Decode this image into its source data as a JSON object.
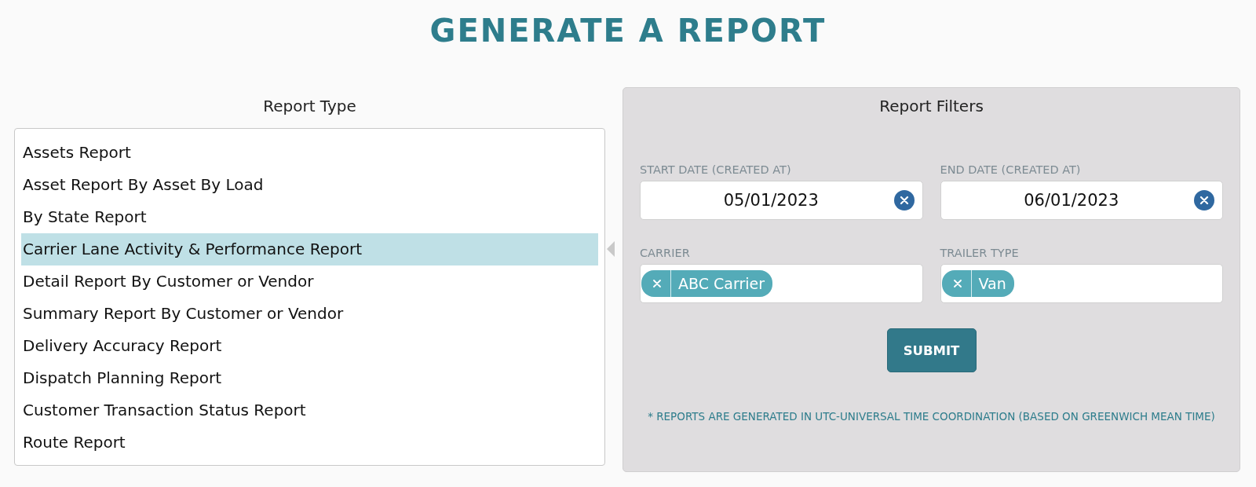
{
  "title": "GENERATE A REPORT",
  "report_type": {
    "heading": "Report Type",
    "items": [
      {
        "label": "Assets Report",
        "selected": false
      },
      {
        "label": "Asset Report By Asset By Load",
        "selected": false
      },
      {
        "label": "By State Report",
        "selected": false
      },
      {
        "label": "Carrier Lane Activity & Performance Report",
        "selected": true
      },
      {
        "label": "Detail Report By Customer or Vendor",
        "selected": false
      },
      {
        "label": "Summary Report By Customer or Vendor",
        "selected": false
      },
      {
        "label": "Delivery Accuracy Report",
        "selected": false
      },
      {
        "label": "Dispatch Planning Report",
        "selected": false
      },
      {
        "label": "Customer Transaction Status Report",
        "selected": false
      },
      {
        "label": "Route Report",
        "selected": false
      }
    ]
  },
  "report_filters": {
    "heading": "Report Filters",
    "fields": [
      {
        "kind": "date",
        "label": "START DATE (CREATED AT)",
        "value": "05/01/2023"
      },
      {
        "kind": "date",
        "label": "END DATE (CREATED AT)",
        "value": "06/01/2023"
      },
      {
        "kind": "tags",
        "label": "CARRIER",
        "tags": [
          "ABC Carrier"
        ]
      },
      {
        "kind": "tags",
        "label": "TRAILER TYPE",
        "tags": [
          "Van"
        ]
      }
    ],
    "submit": "SUBMIT",
    "note": "* REPORTS ARE GENERATED IN UTC-UNIVERSAL TIME COORDINATION (BASED ON GREENWICH MEAN TIME)"
  }
}
